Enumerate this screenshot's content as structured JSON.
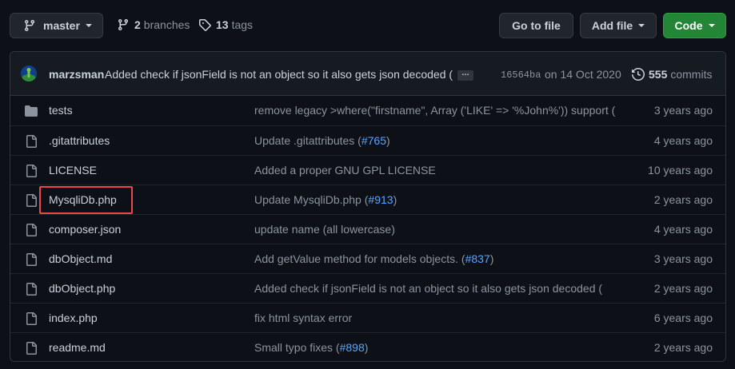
{
  "toolbar": {
    "branch_label": "master",
    "branches_count": "2",
    "branches_label": "branches",
    "tags_count": "13",
    "tags_label": "tags",
    "goto_file_label": "Go to file",
    "add_file_label": "Add file",
    "code_label": "Code"
  },
  "commit": {
    "author": "marzsman",
    "message": "Added check if jsonField is not an object so it also gets json decoded (",
    "ellipsis": "…",
    "sha": "16564ba",
    "date": "on 14 Oct 2020",
    "count": "555",
    "count_label": "commits"
  },
  "files": [
    {
      "type": "dir",
      "name": "tests",
      "message": "remove legacy >where(\"firstname\", Array ('LIKE' => '%John%')) support (",
      "pr": "",
      "pr_suffix": "",
      "age": "3 years ago"
    },
    {
      "type": "file",
      "name": ".gitattributes",
      "message": "Update .gitattributes (",
      "pr": "#765",
      "pr_suffix": ")",
      "age": "4 years ago"
    },
    {
      "type": "file",
      "name": "LICENSE",
      "message": "Added a proper GNU GPL LICENSE",
      "pr": "",
      "pr_suffix": "",
      "age": "10 years ago"
    },
    {
      "type": "file",
      "name": "MysqliDb.php",
      "message": "Update MysqliDb.php (",
      "pr": "#913",
      "pr_suffix": ")",
      "age": "2 years ago"
    },
    {
      "type": "file",
      "name": "composer.json",
      "message": "update name (all lowercase)",
      "pr": "",
      "pr_suffix": "",
      "age": "4 years ago"
    },
    {
      "type": "file",
      "name": "dbObject.md",
      "message": "Add getValue method for models objects. (",
      "pr": "#837",
      "pr_suffix": ")",
      "age": "3 years ago"
    },
    {
      "type": "file",
      "name": "dbObject.php",
      "message": "Added check if jsonField is not an object so it also gets json decoded (",
      "pr": "",
      "pr_suffix": "",
      "age": "2 years ago"
    },
    {
      "type": "file",
      "name": "index.php",
      "message": "fix html syntax error",
      "pr": "",
      "pr_suffix": "",
      "age": "6 years ago"
    },
    {
      "type": "file",
      "name": "readme.md",
      "message": "Small typo fixes (",
      "pr": "#898",
      "pr_suffix": ")",
      "age": "2 years ago"
    }
  ],
  "icons": {
    "branch": "git-branch-icon",
    "tag": "tag-icon",
    "history": "history-icon",
    "folder": "folder-icon",
    "file": "file-icon"
  },
  "colors": {
    "background": "#0d1117",
    "code_button": "#238636",
    "link": "#58a6ff",
    "highlight": "#e5484d"
  }
}
